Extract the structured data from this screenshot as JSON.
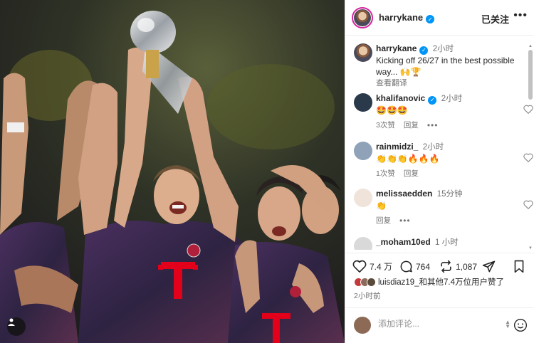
{
  "post_author": {
    "username": "harrykane",
    "follow_status": "已关注"
  },
  "caption": {
    "username": "harrykane",
    "time": "2小时",
    "text": "Kicking off 26/27 in the best possible way... 🙌🏆",
    "translate": "查看翻译"
  },
  "comments": [
    {
      "username": "khalifanovic",
      "verified": true,
      "time": "2小时",
      "text": "🤩🤩🤩",
      "likes": "3次赞",
      "reply": "回复"
    },
    {
      "username": "rainmidzi_",
      "verified": false,
      "time": "2小时",
      "text": "👏👏👏🔥🔥🔥",
      "likes": "1次赞",
      "reply": "回复"
    },
    {
      "username": "melissaedden",
      "verified": false,
      "time": "15分钟",
      "text": "👏",
      "likes": "",
      "reply": "回复"
    },
    {
      "username": "_moham10ed",
      "verified": false,
      "time": "1 小时",
      "text": "👏👏👏",
      "likes": "",
      "reply": ""
    }
  ],
  "actions": {
    "like_count": "7.4 万",
    "comment_count": "764",
    "share_count": "1,087"
  },
  "likes_summary": {
    "text": "luisdiaz19_和其他7.4万位用户赞了"
  },
  "posted_time": "2小时前",
  "composer": {
    "placeholder": "添加评论..."
  },
  "icons": {
    "verified": "verified-badge-icon",
    "like": "heart-icon",
    "comment": "speech-bubble-icon",
    "share": "repost-icon",
    "send": "paper-plane-icon",
    "save": "bookmark-icon"
  },
  "colors": {
    "verified": "#0095f6",
    "jersey": "#3a2a4e",
    "jersey_logo": "#e2001a",
    "story_ring": "#d6249f"
  }
}
